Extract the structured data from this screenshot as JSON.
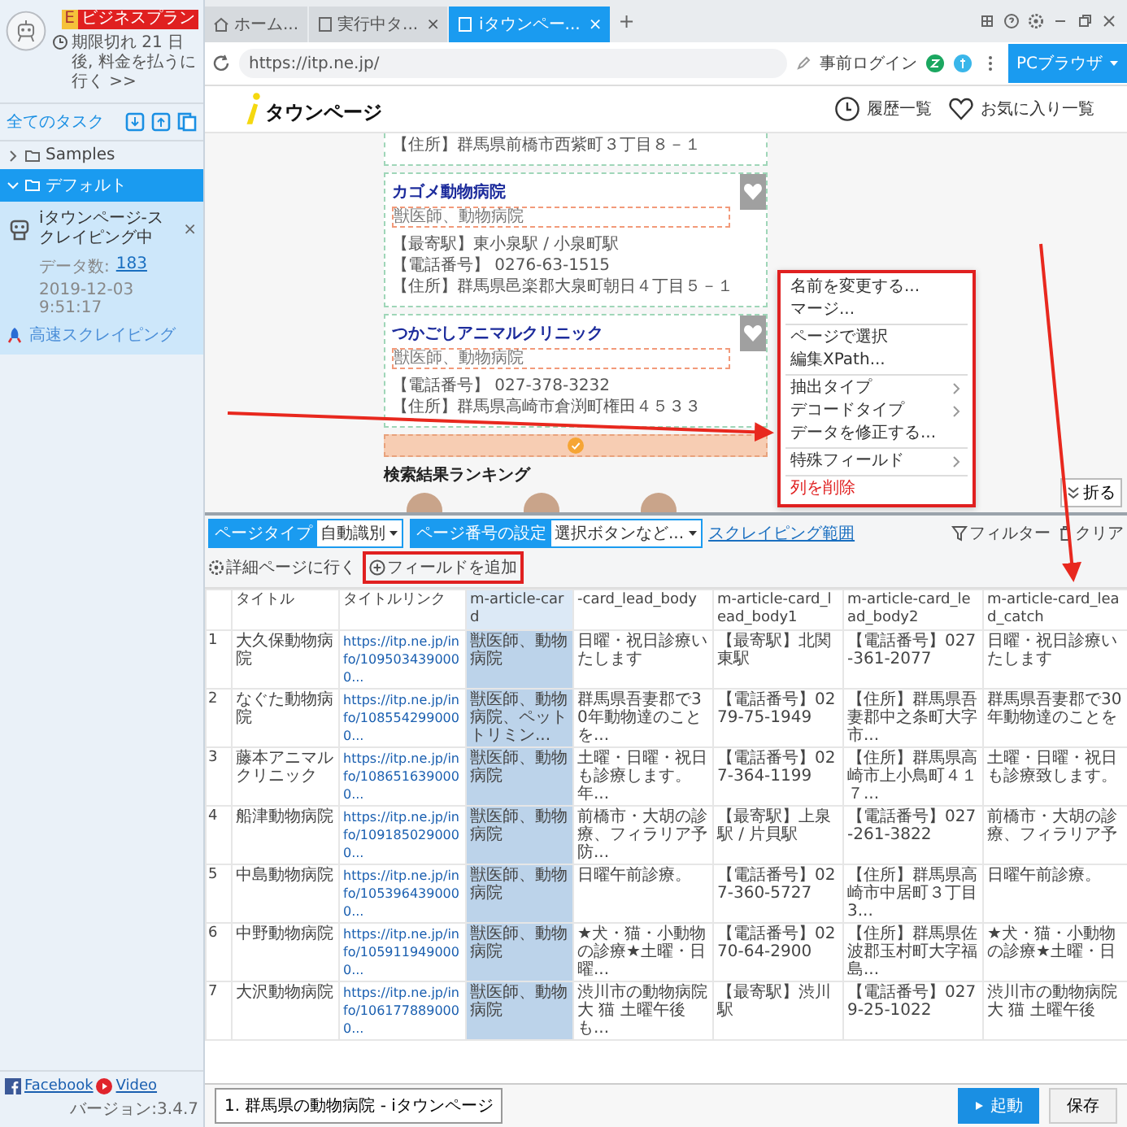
{
  "sidebar": {
    "badges": [
      {
        "text": "E",
        "kind": "trial"
      },
      {
        "text": "ビジネスプラン",
        "kind": "plan"
      }
    ],
    "expiry_notice": "期限切れ 21 日後, 料金を払うに行く >>",
    "section_title": "全てのタスク",
    "tree": [
      {
        "label": "Samples",
        "expanded": false,
        "selected": false
      },
      {
        "label": "デフォルト",
        "expanded": true,
        "selected": true
      }
    ],
    "tasks": [
      {
        "name": "iタウンページ-スクレイピング中",
        "close": "×",
        "count_label": "データ数:",
        "count": "183",
        "time": "2019-12-03 9:51:17",
        "mode": "高速スクレイピング"
      }
    ],
    "footer_links": [
      "Facebook",
      "Video"
    ],
    "version": "バージョン:3.4.7"
  },
  "browser": {
    "tabs": [
      {
        "label": "ホーム...",
        "kind": "home",
        "selected": false
      },
      {
        "label": "実行中タ...",
        "kind": "page",
        "selected": false,
        "close": "×"
      },
      {
        "label": "iタウンペー...",
        "kind": "page",
        "selected": true,
        "close": "×"
      }
    ],
    "new_tab": "+",
    "url": "https://itp.ne.jp/",
    "login": "事前ログイン",
    "mode_button": "PCブラウザ"
  },
  "page": {
    "logo": "タウンページ",
    "nav": [
      {
        "label": "履歴一覧",
        "kind": "history"
      },
      {
        "label": "お気に入り一覧",
        "kind": "favorite"
      }
    ],
    "partial_line": "【住所】群馬県前橋市西紫町３丁目８－１",
    "cards": [
      {
        "title": "カゴメ動物病院",
        "tags": "獣医師、動物病院",
        "lines": [
          "【最寄駅】東小泉駅 / 小泉町駅",
          "【電話番号】 0276-63-1515",
          "【住所】群馬県邑楽郡大泉町朝日４丁目５－１"
        ]
      },
      {
        "title": "つかごしアニマルクリニック",
        "tags": "獣医師、動物病院",
        "lines": [
          "【電話番号】 027-378-3232",
          "【住所】群馬県高崎市倉渕町権田４５３３"
        ]
      }
    ],
    "section_heading": "検索結果ランキング",
    "collapse_button": "折る"
  },
  "context_menu": [
    {
      "label": "名前を変更する...",
      "kind": "item"
    },
    {
      "label": "マージ...",
      "kind": "item"
    },
    {
      "kind": "divider"
    },
    {
      "label": "ページで選択",
      "kind": "item"
    },
    {
      "label": "編集XPath...",
      "kind": "item"
    },
    {
      "kind": "divider"
    },
    {
      "label": "抽出タイプ",
      "kind": "submenu"
    },
    {
      "label": "デコードタイプ",
      "kind": "submenu"
    },
    {
      "label": "データを修正する...",
      "kind": "item"
    },
    {
      "kind": "divider"
    },
    {
      "label": "特殊フィールド",
      "kind": "submenu"
    },
    {
      "kind": "divider"
    },
    {
      "label": "列を削除",
      "kind": "danger"
    }
  ],
  "toolbar": {
    "page_type": {
      "label": "ページタイプ",
      "value": "自動識別"
    },
    "pagination": {
      "label": "ページ番号の設定",
      "value": "選択ボタンなど..."
    },
    "scope_link": "スクレイピング範囲",
    "actions": [
      {
        "label": "フィルター",
        "kind": "filter"
      },
      {
        "label": "クリア",
        "kind": "clear"
      },
      {
        "label": "詳細ページに行く",
        "kind": "detail"
      }
    ],
    "add_field": "フィールドを追加"
  },
  "table": {
    "columns": [
      {
        "selected": false
      },
      {
        "label": "タイトル",
        "selected": false
      },
      {
        "label": "タイトルリンク",
        "selected": false
      },
      {
        "label": "m-article-card",
        "selected": true
      },
      {
        "label": "-card_lead_body",
        "selected": false
      },
      {
        "label": "m-article-card_lead_body1",
        "selected": false
      },
      {
        "label": "m-article-card_lead_body2",
        "selected": false
      },
      {
        "label": "m-article-card_lead_catch",
        "selected": false
      }
    ],
    "rows": [
      [
        "1",
        "大久保動物病院",
        "https://itp.ne.jp/info/1095034390000...",
        "獣医師、動物病院",
        "日曜・祝日診療いたします",
        "【最寄駅】北関東駅",
        "【電話番号】027-361-2077",
        "日曜・祝日診療いたします"
      ],
      [
        "2",
        "なぐた動物病院",
        "https://itp.ne.jp/info/1085542990000...",
        "獣医師、動物病院、ペットトリミン...",
        "群馬県吾妻郡で30年動物達のことを...",
        "【電話番号】0279-75-1949",
        "【住所】群馬県吾妻郡中之条町大字市...",
        "群馬県吾妻郡で30年動物達のことを"
      ],
      [
        "3",
        "藤本アニマルクリニック",
        "https://itp.ne.jp/info/1086516390000...",
        "獣医師、動物病院",
        "土曜・日曜・祝日も診療します。年...",
        "【電話番号】027-364-1199",
        "【住所】群馬県高崎市上小鳥町４１７...",
        "土曜・日曜・祝日も診療致します。"
      ],
      [
        "4",
        "船津動物病院",
        "https://itp.ne.jp/info/1091850290000...",
        "獣医師、動物病院",
        "前橋市・大胡の診療、フィラリア予防...",
        "【最寄駅】上泉駅 / 片貝駅",
        "【電話番号】027-261-3822",
        "前橋市・大胡の診療、フィラリア予"
      ],
      [
        "5",
        "中島動物病院",
        "https://itp.ne.jp/info/1053964390000...",
        "獣医師、動物病院",
        "日曜午前診療。",
        "【電話番号】027-360-5727",
        "【住所】群馬県高崎市中居町３丁目3...",
        "日曜午前診療。"
      ],
      [
        "6",
        "中野動物病院",
        "https://itp.ne.jp/info/1059119490000...",
        "獣医師、動物病院",
        "★犬・猫・小動物の診療★土曜・日曜...",
        "【電話番号】0270-64-2900",
        "【住所】群馬県佐波郡玉村町大字福島...",
        "★犬・猫・小動物の診療★土曜・日"
      ],
      [
        "7",
        "大沢動物病院",
        "https://itp.ne.jp/info/1061778890000...",
        "獣医師、動物病院",
        "渋川市の動物病院大 猫 土曜午後も...",
        "【最寄駅】渋川駅",
        "【電話番号】0279-25-1022",
        "渋川市の動物病院大 猫 土曜午後"
      ]
    ]
  },
  "footer": {
    "tabs": [
      {
        "label": "1. 群馬県の動物病院 - iタウンページ",
        "selected": true
      }
    ],
    "run_button": "起動",
    "save_button": "保存"
  }
}
